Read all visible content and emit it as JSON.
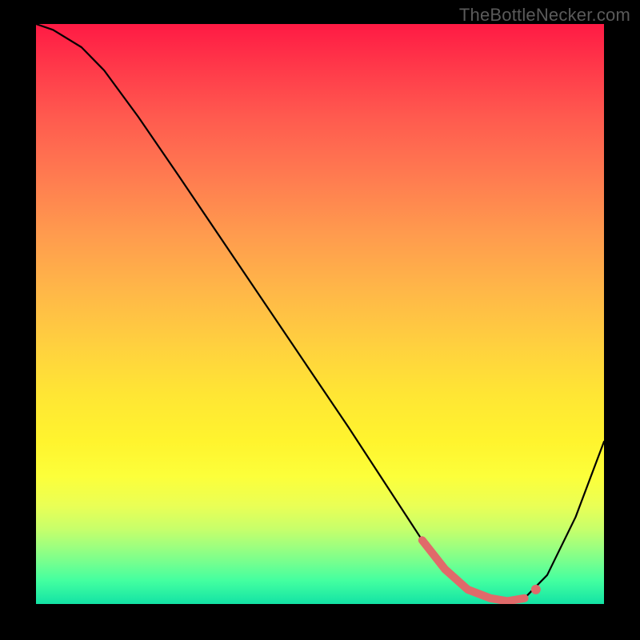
{
  "watermark": "TheBottleNecker.com",
  "chart_data": {
    "type": "line",
    "title": "",
    "xlabel": "",
    "ylabel": "",
    "xlim": [
      0,
      100
    ],
    "ylim": [
      0,
      100
    ],
    "series": [
      {
        "name": "curve",
        "x": [
          0,
          3,
          8,
          12,
          18,
          25,
          35,
          45,
          55,
          62,
          68,
          72,
          76,
          80,
          83,
          86,
          90,
          95,
          100
        ],
        "y": [
          100,
          99,
          96,
          92,
          84,
          74,
          59.5,
          45,
          30.5,
          20,
          11,
          6,
          2.5,
          1,
          0.5,
          1,
          5,
          15,
          28
        ]
      }
    ],
    "highlight_region": {
      "name": "bottom-marker",
      "x": [
        68,
        72,
        76,
        80,
        83,
        86
      ],
      "y": [
        11,
        6,
        2.5,
        1,
        0.5,
        1
      ]
    },
    "highlight_point": {
      "x": 88,
      "y": 2.5
    },
    "background_gradient": {
      "top": "#ff1a44",
      "mid": "#ffe634",
      "bottom": "#13e3a5"
    }
  }
}
